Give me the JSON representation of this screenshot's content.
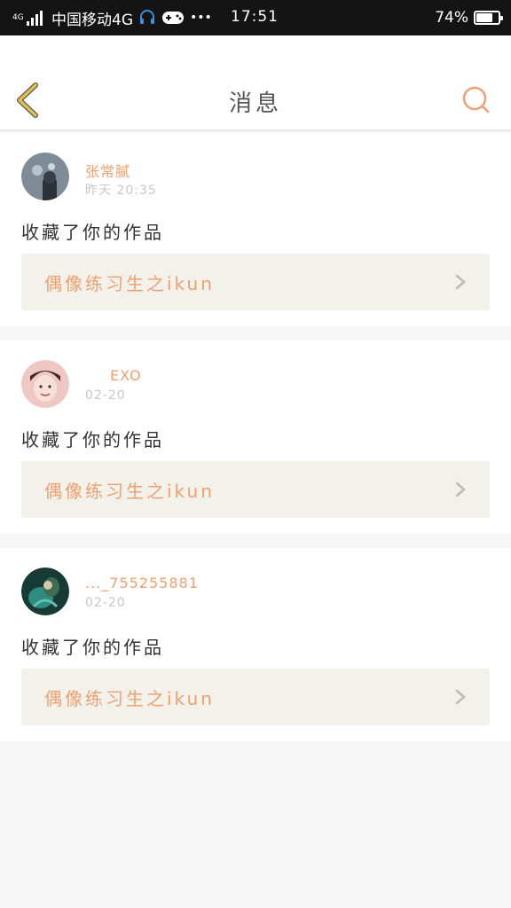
{
  "status_bar": {
    "network_badge": "4G",
    "carrier": "中国移动4G",
    "more": "•••",
    "time": "17:51",
    "battery_percent": "74%",
    "battery_level": 0.74
  },
  "header": {
    "title": "消息"
  },
  "notifications": [
    {
      "username": "张常腻",
      "time": "昨天 20:35",
      "action": "收藏了你的作品",
      "work_title": "偶像练习生之ikun",
      "avatar_color": "#6b7a86"
    },
    {
      "username": "EXO",
      "time": "02-20",
      "action": "收藏了你的作品",
      "work_title": "偶像练习生之ikun",
      "avatar_color": "#e9b9b6"
    },
    {
      "username": "..._755255881",
      "time": "02-20",
      "action": "收藏了你的作品",
      "work_title": "偶像练习生之ikun",
      "avatar_color": "#1f4a44"
    }
  ],
  "colors": {
    "accent": "#f0a070",
    "back_arrow": "#e0c050",
    "link_bg": "#f2f1ea"
  }
}
